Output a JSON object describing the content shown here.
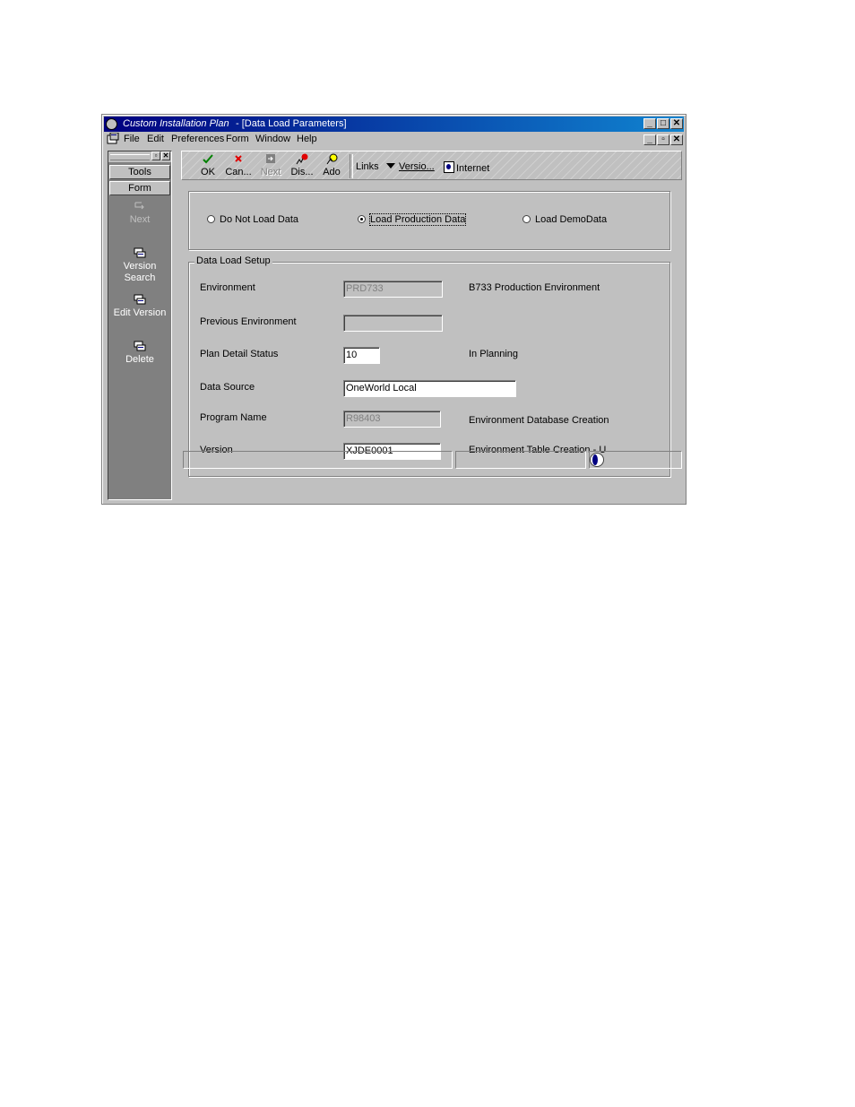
{
  "window": {
    "app_title": "Custom Installation Plan",
    "form_title": " - [Data Load Parameters]"
  },
  "menu": [
    {
      "label": "File"
    },
    {
      "label": "Edit"
    },
    {
      "label": "Preferences"
    },
    {
      "label": "Form"
    },
    {
      "label": "Window"
    },
    {
      "label": "Help"
    }
  ],
  "sidebar": {
    "tools_label": "Tools",
    "form_label": "Form",
    "items": [
      {
        "label": "Next",
        "icon": "next-icon",
        "disabled": true
      },
      {
        "label": "Version Search",
        "icon": "version-search-icon"
      },
      {
        "label": "Edit Version",
        "icon": "edit-version-icon"
      },
      {
        "label": "Delete",
        "icon": "delete-icon"
      }
    ]
  },
  "toolbar": {
    "ok": "OK",
    "cancel": "Can...",
    "next": "Next",
    "display": "Dis...",
    "add": "Ado",
    "links": "Links",
    "versions": "Versio...",
    "internet": "Internet"
  },
  "load_options": {
    "options": [
      {
        "label": "Do Not Load Data",
        "selected": false
      },
      {
        "label": "Load Production Data",
        "selected": true
      },
      {
        "label": "Load DemoData",
        "selected": false
      }
    ]
  },
  "setup": {
    "title": "Data Load Setup",
    "environment": {
      "label": "Environment",
      "value": "PRD733",
      "desc": "B733 Production Environment"
    },
    "previous_environment": {
      "label": "Previous Environment",
      "value": ""
    },
    "plan_detail_status": {
      "label": "Plan Detail Status",
      "value": "10",
      "desc": "In Planning"
    },
    "data_source": {
      "label": "Data Source",
      "value": "OneWorld Local"
    },
    "program_name": {
      "label": "Program Name",
      "value": "R98403",
      "desc": "Environment Database Creation"
    },
    "version": {
      "label": "Version",
      "value": "XJDE0001",
      "desc": "Environment Table Creation - U"
    }
  },
  "colors": {
    "title_bar": "#000080",
    "face": "#c0c0c0",
    "sidebar_bg": "#808080"
  }
}
